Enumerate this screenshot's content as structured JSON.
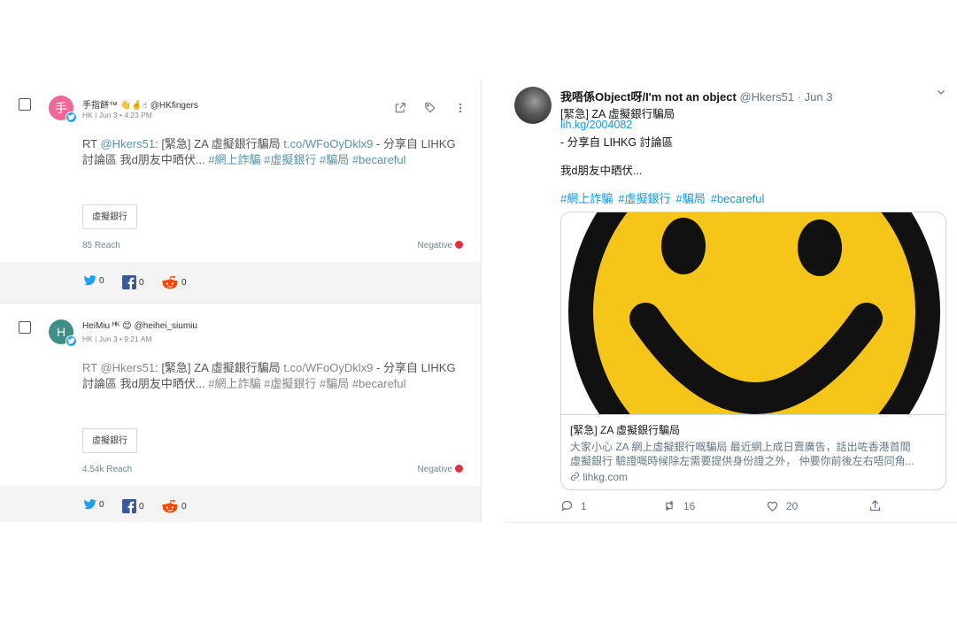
{
  "left": {
    "posts": [
      {
        "author_name": "手指餅™ 👋🤞☝",
        "handle": "@HKfingers",
        "avatar_letter": "手",
        "avatar_color": "#f0679a",
        "meta": "HK | Jun 3 • 4:23 PM",
        "text_prefix": "RT ",
        "text_mention": "@Hkers51",
        "text_a": ": [緊急] ZA 虛擬銀行騙局 ",
        "text_link": "t.co/WFoOyDklx9",
        "text_b": " - 分享自 LIHKG 討論區 我d朋友中晒伏... ",
        "text_tags": "#網上詐騙 #虛擬銀行 #騙局 #becareful",
        "tag": "虛擬銀行",
        "reach": "85 Reach",
        "sentiment": "Negative",
        "twitter_count": "0",
        "facebook_count": "0",
        "reddit_count": "0"
      },
      {
        "author_name": "HeiMiu ᴴᴷ 😊",
        "handle": "@heihei_siumiu",
        "avatar_letter": "H",
        "avatar_color": "#3f8f86",
        "meta": "HK | Jun 3 • 9:21 AM",
        "text_prefix": "RT ",
        "text_mention": "@Hkers51",
        "text_a": ": [緊急] ZA 虛擬銀行騙局 ",
        "text_link": "t.co/WFoOyDklx9",
        "text_b": " - 分享自 LIHKG 討論區 我d朋友中晒伏... ",
        "text_tags": "#網上詐騙 #虛擬銀行 #騙局 #becareful",
        "tag": "虛擬銀行",
        "reach": "4.54k Reach",
        "sentiment": "Negative",
        "twitter_count": "0",
        "facebook_count": "0",
        "reddit_count": "0"
      }
    ]
  },
  "tweet": {
    "name": "我唔係Object呀/I'm not an object",
    "handle": "@Hkers51",
    "dot": "·",
    "date": "Jun 3",
    "line1": "[緊急] ZA 虛擬銀行騙局",
    "link": "lih.kg/2004082",
    "line2": "- 分享自 LIHKG 討論區",
    "line3": "我d朋友中晒伏...",
    "hashtags": [
      "#網上詐騙",
      "#虛擬銀行",
      "#騙局",
      "#becareful"
    ],
    "card": {
      "title": "[緊急] ZA 虛擬銀行騙局",
      "desc1": "大家小心 ZA 網上虛擬銀行嘅騙局 最近網上成日賣廣告，話出咗香港首間",
      "desc2": "虛擬銀行 驗證嘅時候除左需要提供身份證之外， 仲要你前後左右唔同角...",
      "domain": "lihkg.com"
    },
    "replies": "1",
    "retweets": "16",
    "likes": "20"
  },
  "colors": {
    "twitter_blue": "#1da1f2",
    "facebook_blue": "#3b5998",
    "reddit_orange": "#ff4500",
    "negative_red": "#e0333f",
    "link_teal": "#5a93a8",
    "smiley_yellow": "#f5c518"
  },
  "icons": [
    "open-external-icon",
    "tag-icon",
    "more-vertical-icon",
    "twitter-icon",
    "facebook-icon",
    "reddit-icon",
    "chevron-down-icon",
    "reply-icon",
    "retweet-icon",
    "like-icon",
    "share-icon",
    "link-icon"
  ]
}
